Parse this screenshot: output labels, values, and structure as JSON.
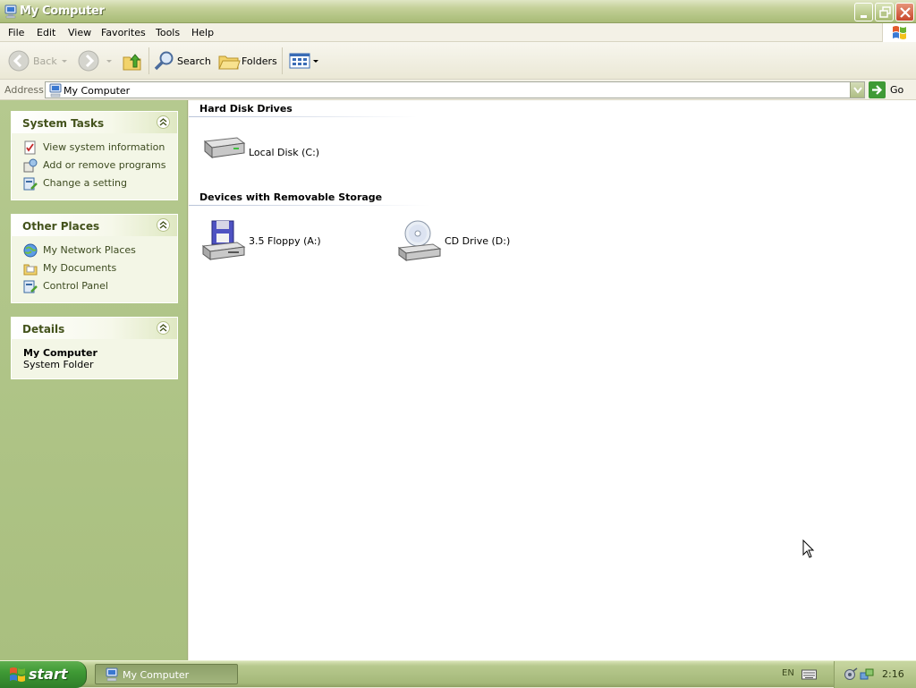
{
  "window": {
    "title": "My Computer",
    "controls": [
      "minimize-icon",
      "restore-icon",
      "close-icon"
    ]
  },
  "menu": {
    "items": [
      "File",
      "Edit",
      "View",
      "Favorites",
      "Tools",
      "Help"
    ]
  },
  "toolbar": {
    "back_label": "Back",
    "search_label": "Search",
    "folders_label": "Folders"
  },
  "address": {
    "label": "Address",
    "value": "My Computer",
    "go_label": "Go"
  },
  "sidebar": {
    "system_tasks": {
      "title": "System Tasks",
      "items": [
        {
          "label": "View system information",
          "icon": "system-info-icon"
        },
        {
          "label": "Add or remove programs",
          "icon": "add-remove-programs-icon"
        },
        {
          "label": "Change a setting",
          "icon": "control-panel-icon"
        }
      ]
    },
    "other_places": {
      "title": "Other Places",
      "items": [
        {
          "label": "My Network Places",
          "icon": "network-places-icon"
        },
        {
          "label": "My Documents",
          "icon": "documents-folder-icon"
        },
        {
          "label": "Control Panel",
          "icon": "control-panel-icon"
        }
      ]
    },
    "details": {
      "title": "Details",
      "name": "My Computer",
      "type": "System Folder"
    }
  },
  "content": {
    "groups": [
      {
        "title": "Hard Disk Drives",
        "items": [
          {
            "label": "Local Disk (C:)",
            "icon": "hard-disk-icon"
          }
        ]
      },
      {
        "title": "Devices with Removable Storage",
        "items": [
          {
            "label": "3.5 Floppy (A:)",
            "icon": "floppy-drive-icon"
          },
          {
            "label": "CD Drive (D:)",
            "icon": "cd-drive-icon"
          }
        ]
      }
    ]
  },
  "taskbar": {
    "start_label": "start",
    "task_label": "My Computer",
    "language": "EN",
    "clock": "2:16"
  },
  "colors": {
    "title_bar": "#b4c585",
    "task_pane": "#a9bf7f",
    "panel_title": "#43521b",
    "start_button": "#3f9a35"
  }
}
